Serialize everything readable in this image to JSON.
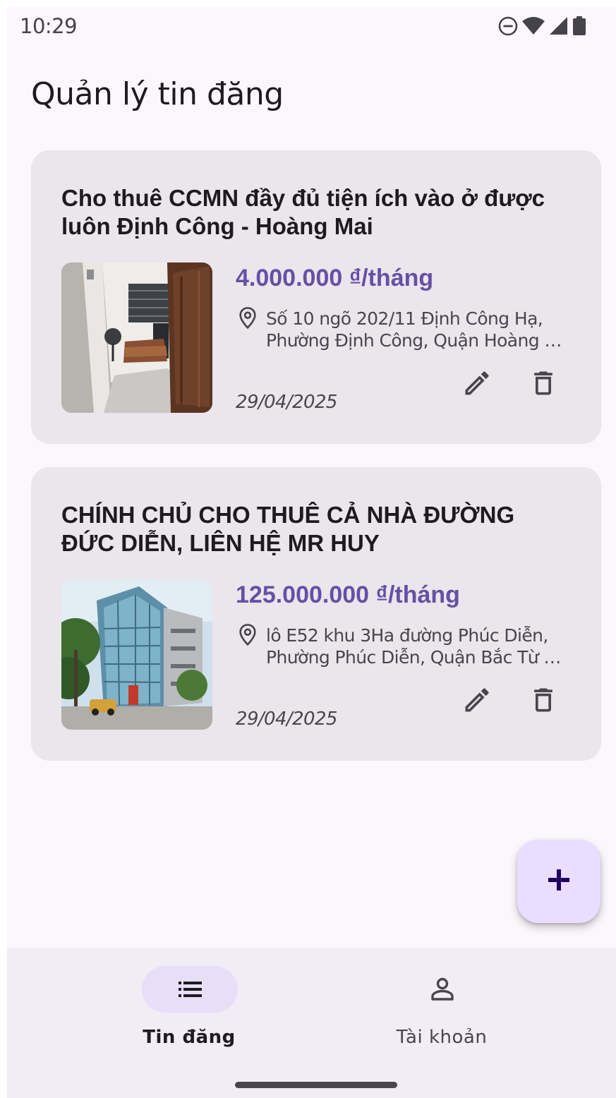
{
  "status_bar": {
    "time": "10:29",
    "icons": [
      "do-not-disturb-icon",
      "wifi-icon",
      "signal-icon",
      "battery-icon"
    ]
  },
  "page": {
    "title": "Quản lý tin đăng"
  },
  "listings": [
    {
      "title": "Cho thuê CCMN đầy đủ tiện ích vào ở được luôn Định Công - Hoàng Mai",
      "price": "4.000.000 ₫/tháng",
      "address_line1": "Số 10 ngõ 202/11 Định Công Hạ,",
      "address_line2": "Phường Định Công, Quận Hoàng Mai",
      "date": "29/04/2025",
      "photo": "room-photo"
    },
    {
      "title": "CHÍNH CHỦ CHO THUÊ CẢ NHÀ ĐƯỜNG ĐỨC DIỄN, LIÊN HỆ MR HUY",
      "price": "125.000.000 ₫/tháng",
      "address_line1": "lô E52 khu 3Ha đường Phúc Diễn,",
      "address_line2": "Phường Phúc Diễn, Quận Bắc Từ Liêm",
      "date": "29/04/2025",
      "photo": "building-photo"
    }
  ],
  "fab": {
    "icon": "add-icon"
  },
  "bottom_nav": {
    "items": [
      {
        "label": "Tin đăng",
        "icon": "list-icon",
        "active": true
      },
      {
        "label": "Tài khoản",
        "icon": "person-icon",
        "active": false
      }
    ]
  },
  "colors": {
    "primary": "#6650a4",
    "card_bg": "#ebe5ec",
    "background": "#fcf7fd",
    "fab_bg": "#eaddff",
    "nav_bg": "#f2ecf4",
    "nav_indicator": "#e8def8"
  }
}
